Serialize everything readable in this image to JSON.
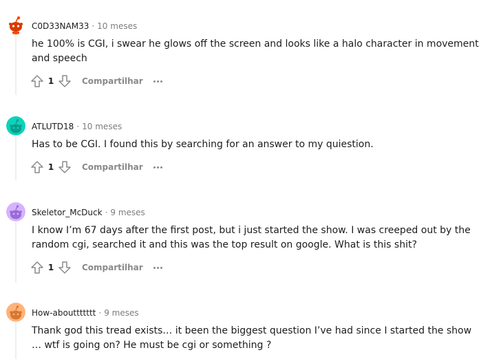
{
  "comments": [
    {
      "username": "C0D33NAM33",
      "separator": "·",
      "time": "10 meses",
      "text": "he 100% is CGI, i swear he glows off the screen and looks like a halo character in movement and speech",
      "score": "1",
      "share_label": "Compartilhar",
      "avatar_color": "#ff4500",
      "avatar_icon": "reddit-snoo-icon"
    },
    {
      "username": "ATLUTD18",
      "separator": "·",
      "time": "10 meses",
      "text": "Has to be CGI. I found this by searching for an answer to my quiestion.",
      "score": "1",
      "share_label": "Compartilhar",
      "avatar_color": "#0dd3bb",
      "avatar_icon": "reddit-snoo-icon"
    },
    {
      "username": "Skeletor_McDuck",
      "separator": "·",
      "time": "9 meses",
      "text": "I know I’m 67 days after the first post, but i just started the show. I was creeped out by the random cgi, searched it and this was the top result on google. What is this shit?",
      "score": "1",
      "share_label": "Compartilhar",
      "avatar_color": "#c18cff",
      "avatar_icon": "reddit-snoo-icon"
    },
    {
      "username": "How-abouttttttt",
      "separator": "·",
      "time": "9 meses",
      "text": "Thank god this tread exists… it been the biggest question I’ve had since I started the show … wtf is going on? He must be cgi or something ?",
      "score": "",
      "share_label": "",
      "avatar_color": "#ff9a57",
      "avatar_icon": "reddit-snoo-icon"
    }
  ]
}
